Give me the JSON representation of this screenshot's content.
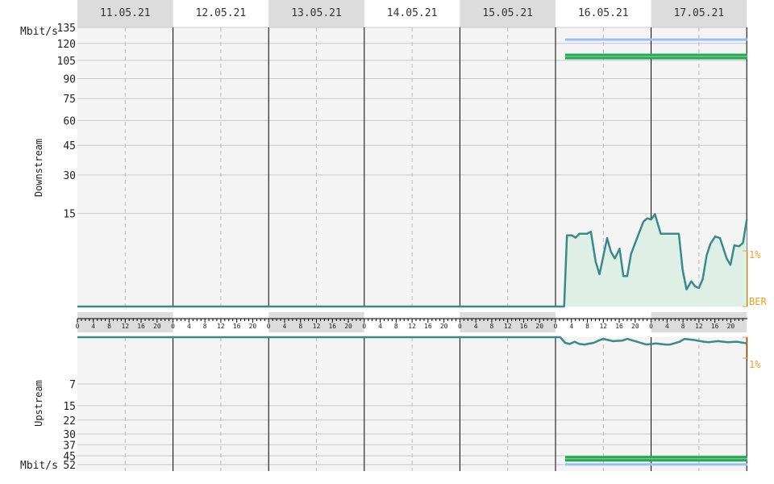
{
  "chart_data": {
    "type": "line",
    "dates": [
      "11.05.21",
      "12.05.21",
      "13.05.21",
      "14.05.21",
      "15.05.21",
      "16.05.21",
      "17.05.21"
    ],
    "hour_ticks": [
      "0",
      "4",
      "8",
      "12",
      "16",
      "20"
    ],
    "units": {
      "top": "Mbit/s",
      "bottom": "Mbit/s"
    },
    "downstream": {
      "ylabel": "Downstream",
      "ticks": [
        "135",
        "120",
        "105",
        "90",
        "75",
        "60",
        "45",
        "30",
        "15"
      ],
      "max_line": {
        "start_day": 5.1,
        "end_day": 7.0,
        "value": 123.5
      },
      "attainable_line": {
        "start_day": 5.1,
        "end_day": 7.0,
        "value": 108
      },
      "noise_series": {
        "name": "",
        "points": [
          [
            0,
            0
          ],
          [
            5.09,
            0
          ],
          [
            5.12,
            8.8
          ],
          [
            5.17,
            8.8
          ],
          [
            5.21,
            8.2
          ],
          [
            5.25,
            9.2
          ],
          [
            5.33,
            9.2
          ],
          [
            5.37,
            9.7
          ],
          [
            5.42,
            3.5
          ],
          [
            5.46,
            1.8
          ],
          [
            5.54,
            8.1
          ],
          [
            5.58,
            5.2
          ],
          [
            5.62,
            4.0
          ],
          [
            5.67,
            5.8
          ],
          [
            5.71,
            1.6
          ],
          [
            5.75,
            1.6
          ],
          [
            5.79,
            4.8
          ],
          [
            5.83,
            6.8
          ],
          [
            5.88,
            9.8
          ],
          [
            5.92,
            12.5
          ],
          [
            5.96,
            13.5
          ],
          [
            6.0,
            13.1
          ],
          [
            6.04,
            14.8
          ],
          [
            6.1,
            9.2
          ],
          [
            6.29,
            9.2
          ],
          [
            6.33,
            2.3
          ],
          [
            6.37,
            0.5
          ],
          [
            6.42,
            1.1
          ],
          [
            6.46,
            0.7
          ],
          [
            6.5,
            0.6
          ],
          [
            6.54,
            1.3
          ],
          [
            6.58,
            4.5
          ],
          [
            6.62,
            6.8
          ],
          [
            6.67,
            8.5
          ],
          [
            6.72,
            8.1
          ],
          [
            6.79,
            4.0
          ],
          [
            6.83,
            3.0
          ],
          [
            6.87,
            6.5
          ],
          [
            6.92,
            6.3
          ],
          [
            6.96,
            7.0
          ],
          [
            7.0,
            13.0
          ],
          [
            7.0,
            13.2
          ]
        ]
      },
      "ber_top_label": "1%",
      "ber_label": "BER"
    },
    "upstream": {
      "ylabel": "Upstream",
      "ticks": [
        "7",
        "15",
        "22",
        "30",
        "37",
        "45",
        "52"
      ],
      "max_line": {
        "start_day": 5.1,
        "end_day": 7.0,
        "value": 52.5
      },
      "attainable_line": {
        "start_day": 5.1,
        "end_day": 7.0,
        "value": 47
      },
      "noise_series": {
        "name": "",
        "points": [
          [
            0,
            0
          ],
          [
            5.05,
            0
          ],
          [
            5.1,
            1.0
          ],
          [
            5.15,
            1.2
          ],
          [
            5.2,
            0.8
          ],
          [
            5.25,
            1.2
          ],
          [
            5.3,
            1.3
          ],
          [
            5.4,
            1.0
          ],
          [
            5.45,
            0.6
          ],
          [
            5.5,
            0.3
          ],
          [
            5.6,
            0.7
          ],
          [
            5.7,
            0.6
          ],
          [
            5.75,
            0.3
          ],
          [
            5.85,
            0.8
          ],
          [
            5.95,
            1.3
          ],
          [
            6.05,
            1.1
          ],
          [
            6.15,
            1.3
          ],
          [
            6.2,
            1.3
          ],
          [
            6.3,
            0.8
          ],
          [
            6.35,
            0.3
          ],
          [
            6.45,
            0.5
          ],
          [
            6.55,
            0.8
          ],
          [
            6.6,
            0.9
          ],
          [
            6.7,
            0.7
          ],
          [
            6.8,
            0.9
          ],
          [
            6.9,
            0.8
          ],
          [
            7.0,
            1.1
          ]
        ]
      },
      "ber_bottom_label": "1%"
    },
    "colors": {
      "plot_bg": "#f4f4f4",
      "band": "#dcdcdc",
      "grid": "#c8c8c8",
      "day_line": "#000000",
      "noise_line": "#3a8a88",
      "noise_fill": "#deefe6",
      "max_line": "#98c0f0",
      "attainable_line": "#22aa55",
      "ber": "#f0a020"
    }
  }
}
